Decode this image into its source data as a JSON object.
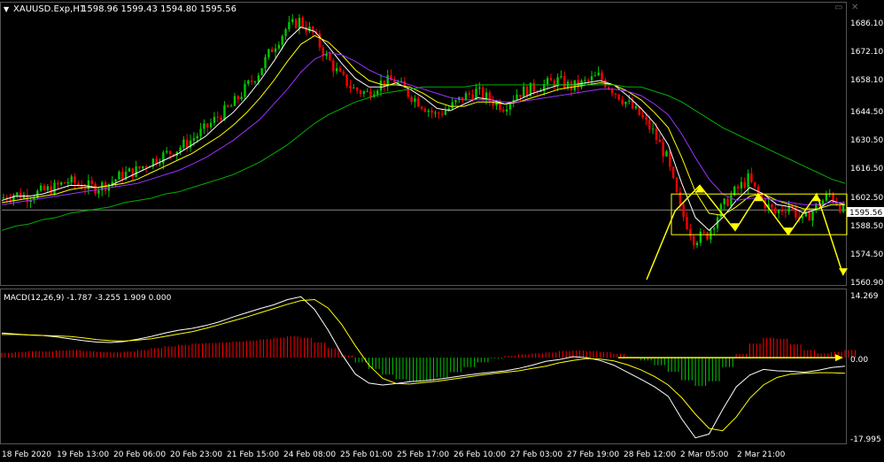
{
  "header": {
    "arrow": "▼",
    "symbol": "XAUUSD.Exp,H1",
    "ohlc": "1598.96 1599.43 1594.80 1595.56"
  },
  "price_axis": {
    "ticks": [
      "1686.10",
      "1672.10",
      "1658.10",
      "1644.50",
      "1630.50",
      "1616.50",
      "1602.50",
      "1588.50",
      "1574.50",
      "1560.90"
    ],
    "current": "1595.56"
  },
  "macd_axis": {
    "ticks": [
      "14.269",
      "0.00",
      "-17.995"
    ]
  },
  "indicator": {
    "label": "MACD(12,26,9) -1.787 -3.255 1.909 0.000"
  },
  "time_axis": {
    "labels": [
      "18 Feb 2020",
      "19 Feb 13:00",
      "20 Feb 06:00",
      "20 Feb 23:00",
      "21 Feb 15:00",
      "24 Feb 08:00",
      "25 Feb 01:00",
      "25 Feb 17:00",
      "26 Feb 10:00",
      "27 Feb 03:00",
      "27 Feb 19:00",
      "28 Feb 12:00",
      "2 Mar 05:00",
      "2 Mar 21:00"
    ]
  },
  "colors": {
    "bull": "#00c800",
    "bear": "#ff0000",
    "fast_ma": "#ffffff",
    "mid_ma": "#ffff00",
    "slow_ma": "#9b30ff",
    "long_ma": "#00b000",
    "annotation": "#ffff00",
    "grid": "#3a3a3a"
  },
  "chart_data": [
    {
      "type": "candlestick",
      "title": "XAUUSD.Exp,H1",
      "ylim": [
        1560.9,
        1692
      ],
      "x": [
        "18 Feb 2020",
        "19 Feb 13:00",
        "20 Feb 06:00",
        "20 Feb 23:00",
        "21 Feb 15:00",
        "24 Feb 08:00",
        "25 Feb 01:00",
        "25 Feb 17:00",
        "26 Feb 10:00",
        "27 Feb 03:00",
        "27 Feb 19:00",
        "28 Feb 12:00",
        "2 Mar 05:00",
        "2 Mar 21:00"
      ],
      "close_path": [
        1601,
        1603,
        1602,
        1604,
        1606,
        1609,
        1607,
        1606,
        1608,
        1612,
        1614,
        1618,
        1621,
        1624,
        1628,
        1633,
        1639,
        1644,
        1652,
        1660,
        1671,
        1680,
        1684,
        1678,
        1667,
        1658,
        1652,
        1650,
        1655,
        1656,
        1650,
        1645,
        1640,
        1643,
        1648,
        1651,
        1647,
        1644,
        1650,
        1652,
        1654,
        1656,
        1653,
        1655,
        1658,
        1652,
        1646,
        1640,
        1632,
        1620,
        1596,
        1582,
        1584,
        1596,
        1604,
        1610,
        1600,
        1594,
        1598,
        1590,
        1597,
        1603,
        1595.56
      ],
      "series": [
        {
          "name": "fast_ma",
          "values": [
            1600,
            1602,
            1602,
            1603,
            1605,
            1607,
            1607,
            1606,
            1607,
            1610,
            1613,
            1616,
            1619,
            1622,
            1626,
            1630,
            1636,
            1641,
            1648,
            1656,
            1665,
            1675,
            1681,
            1679,
            1672,
            1664,
            1657,
            1653,
            1653,
            1655,
            1652,
            1648,
            1643,
            1642,
            1645,
            1648,
            1647,
            1645,
            1647,
            1650,
            1652,
            1654,
            1654,
            1655,
            1656,
            1654,
            1649,
            1643,
            1636,
            1626,
            1608,
            1592,
            1586,
            1592,
            1600,
            1606,
            1603,
            1598,
            1597,
            1594,
            1596,
            1600,
            1598
          ]
        },
        {
          "name": "mid_ma",
          "values": [
            1599,
            1600,
            1601,
            1602,
            1603,
            1605,
            1606,
            1606,
            1607,
            1608,
            1610,
            1613,
            1616,
            1619,
            1622,
            1626,
            1630,
            1635,
            1641,
            1648,
            1656,
            1665,
            1673,
            1677,
            1674,
            1668,
            1661,
            1656,
            1654,
            1654,
            1653,
            1650,
            1646,
            1644,
            1644,
            1646,
            1646,
            1645,
            1646,
            1648,
            1650,
            1652,
            1653,
            1654,
            1655,
            1654,
            1651,
            1647,
            1641,
            1634,
            1620,
            1604,
            1594,
            1593,
            1597,
            1602,
            1603,
            1600,
            1598,
            1596,
            1596,
            1598,
            1598
          ]
        },
        {
          "name": "slow_ma",
          "values": [
            1598,
            1599,
            1600,
            1601,
            1602,
            1603,
            1604,
            1605,
            1606,
            1607,
            1608,
            1610,
            1612,
            1614,
            1617,
            1620,
            1624,
            1628,
            1633,
            1638,
            1645,
            1652,
            1660,
            1666,
            1669,
            1668,
            1665,
            1661,
            1658,
            1656,
            1654,
            1652,
            1650,
            1648,
            1647,
            1647,
            1647,
            1646,
            1646,
            1647,
            1648,
            1649,
            1650,
            1651,
            1652,
            1652,
            1651,
            1649,
            1645,
            1640,
            1631,
            1620,
            1610,
            1603,
            1600,
            1601,
            1601,
            1600,
            1599,
            1598,
            1598,
            1599,
            1599
          ]
        },
        {
          "name": "long_ma",
          "values": [
            1586,
            1588,
            1589,
            1591,
            1592,
            1594,
            1595,
            1596,
            1597,
            1599,
            1600,
            1601,
            1603,
            1604,
            1606,
            1608,
            1610,
            1612,
            1615,
            1618,
            1622,
            1626,
            1631,
            1636,
            1640,
            1643,
            1646,
            1648,
            1650,
            1651,
            1652,
            1653,
            1653,
            1653,
            1653,
            1654,
            1654,
            1654,
            1654,
            1654,
            1654,
            1654,
            1654,
            1654,
            1654,
            1654,
            1653,
            1653,
            1651,
            1649,
            1646,
            1642,
            1638,
            1634,
            1631,
            1628,
            1625,
            1622,
            1619,
            1616,
            1613,
            1610,
            1608
          ]
        }
      ]
    },
    {
      "type": "bar",
      "title": "MACD(12,26,9) -1.787 -3.255 1.909 0.000",
      "ylim": [
        -17.995,
        14.269
      ],
      "histogram": [
        1,
        1.2,
        1.4,
        1.3,
        1.5,
        1.6,
        1.4,
        1.2,
        1.1,
        1.3,
        1.6,
        2,
        2.4,
        2.7,
        3,
        3.1,
        3.2,
        3.4,
        3.6,
        3.9,
        4.2,
        4.5,
        4.2,
        3.2,
        2,
        0.5,
        -1,
        -2.4,
        -3.6,
        -4.6,
        -5.1,
        -4.9,
        -4.2,
        -3.1,
        -2,
        -1,
        -0.2,
        0.4,
        0.7,
        0.9,
        1.1,
        1.4,
        1.5,
        1.4,
        1.2,
        0.8,
        0.2,
        -0.6,
        -1.6,
        -3,
        -4.8,
        -6,
        -5,
        -2,
        0.8,
        3,
        4.2,
        4,
        2.8,
        1.6,
        0.9,
        1.2,
        1.6
      ],
      "series": [
        {
          "name": "macd",
          "values": [
            5.2,
            5,
            4.8,
            4.7,
            4.4,
            4,
            3.6,
            3.3,
            3.2,
            3.4,
            3.9,
            4.5,
            5.2,
            5.8,
            6.2,
            6.8,
            7.6,
            8.6,
            9.5,
            10.4,
            11.2,
            12.3,
            12.9,
            10.2,
            5.8,
            0.7,
            -3.5,
            -5.4,
            -5.8,
            -5.5,
            -5.1,
            -4.9,
            -4.6,
            -4.2,
            -3.8,
            -3.4,
            -3.1,
            -2.8,
            -2.3,
            -1.6,
            -0.8,
            -0.4,
            0.2,
            0,
            -0.6,
            -1.6,
            -3.1,
            -4.6,
            -6.2,
            -8.2,
            -13,
            -17,
            -16.2,
            -11,
            -6.2,
            -3.7,
            -2.5,
            -2.8,
            -2.9,
            -3.1,
            -2.7,
            -2.1,
            -1.8
          ]
        },
        {
          "name": "signal",
          "values": [
            4.9,
            4.9,
            4.8,
            4.7,
            4.6,
            4.5,
            4.2,
            3.8,
            3.6,
            3.5,
            3.7,
            4,
            4.5,
            5,
            5.5,
            6.2,
            7,
            7.8,
            8.6,
            9.5,
            10.4,
            11.3,
            12.1,
            12.3,
            10.5,
            7,
            2.5,
            -1.6,
            -4.4,
            -5.5,
            -5.6,
            -5.3,
            -5,
            -4.6,
            -4.2,
            -3.8,
            -3.4,
            -3.1,
            -2.8,
            -2.3,
            -1.8,
            -1.1,
            -0.6,
            -0.2,
            -0.3,
            -0.7,
            -1.5,
            -2.6,
            -4,
            -5.8,
            -8.5,
            -12,
            -15,
            -15.5,
            -12.6,
            -8.6,
            -5.8,
            -4.2,
            -3.5,
            -3.3,
            -3.2,
            -3.2,
            -3.3
          ]
        }
      ]
    }
  ]
}
